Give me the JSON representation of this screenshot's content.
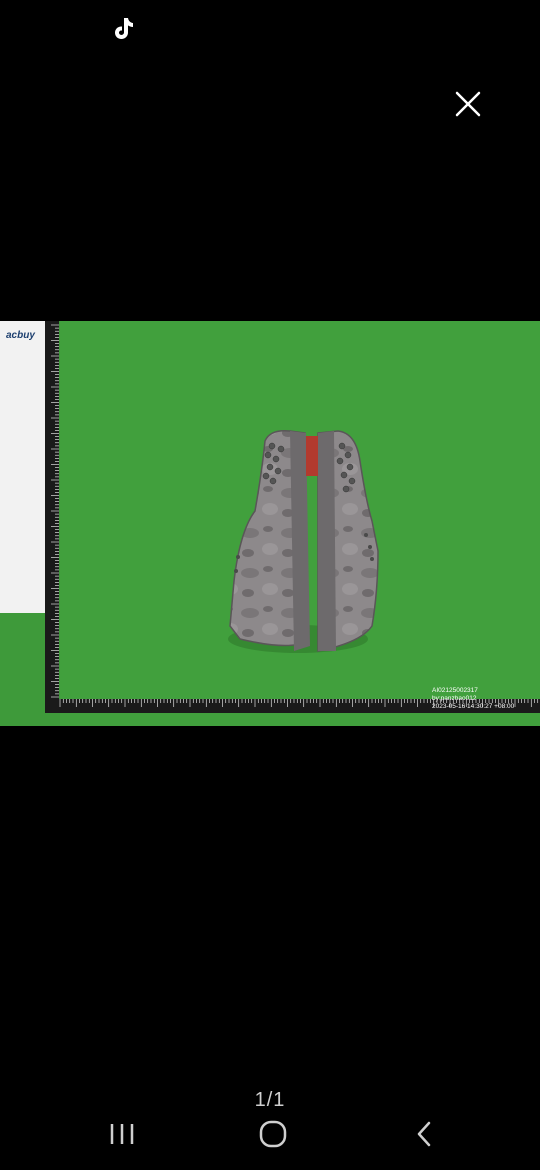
{
  "app": {
    "status_icon": "tiktok-icon",
    "close_icon": "close-icon"
  },
  "photo": {
    "logo_text": "acbuy",
    "watermark": {
      "id": "AI02125002317",
      "by": "by:panzhao012",
      "timestamp": "2023-05-16 14:30:27 +08:00"
    },
    "colors": {
      "background": "#3e9a3a",
      "shoe": "#8a8688",
      "ruler": "#111111"
    }
  },
  "viewer": {
    "counter": "1/1"
  },
  "navbar": {
    "recent_icon": "recent-apps-icon",
    "home_icon": "home-icon",
    "back_icon": "back-icon"
  }
}
